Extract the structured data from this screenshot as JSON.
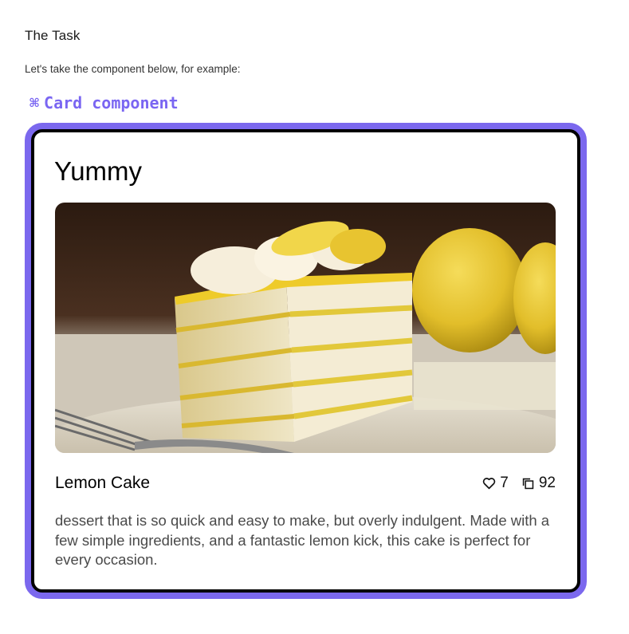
{
  "section": {
    "title": "The Task",
    "intro": "Let's take the component below, for example:"
  },
  "component_label": {
    "icon": "command-icon",
    "symbol": "⌘",
    "text": "Card component",
    "color": "#7b68ee"
  },
  "card": {
    "title": "Yummy",
    "image": "lemon-cake-photo",
    "name": "Lemon Cake",
    "likes": "7",
    "likes_icon": "heart-icon",
    "copies": "92",
    "copies_icon": "copy-icon",
    "description": "dessert that is so quick and easy to make, but overly indulgent. Made with a few simple ingredients, and a fantastic lemon kick, this cake is perfect for every occasion.",
    "border_color": "#000000"
  }
}
